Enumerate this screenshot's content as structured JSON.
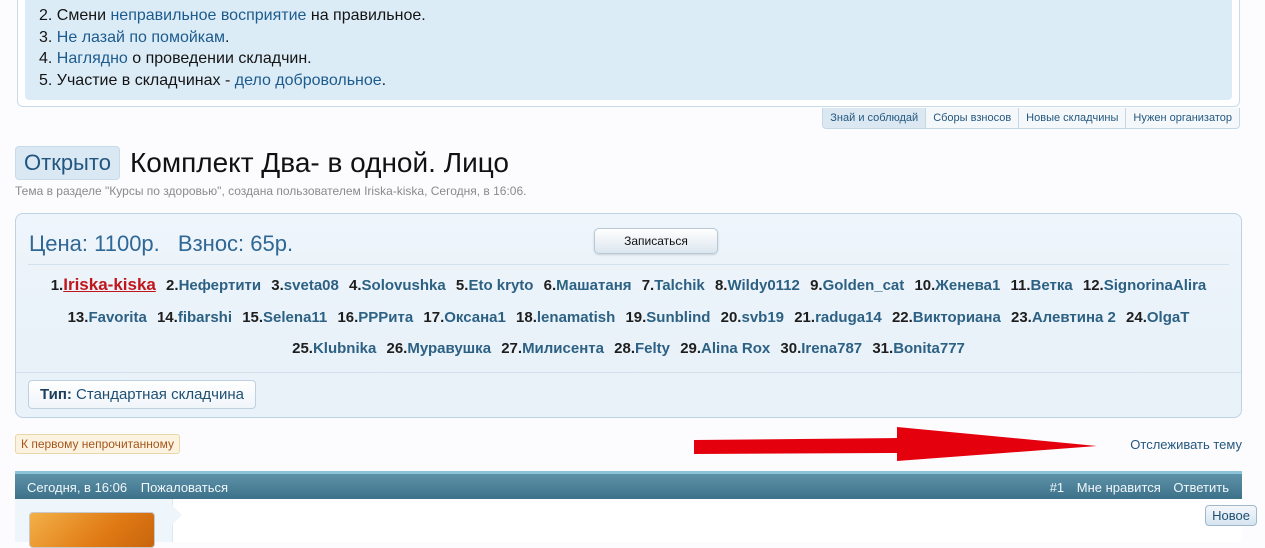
{
  "rules": {
    "lines": [
      {
        "num": "2.",
        "before": "Смени ",
        "link": "неправильное восприятие",
        "after": " на правильное."
      },
      {
        "num": "3.",
        "before": "",
        "link": "Не лазай по помойкам",
        "after": "."
      },
      {
        "num": "4.",
        "before": "",
        "link": "Наглядно",
        "after": " о проведении складчин."
      },
      {
        "num": "5.",
        "before": "Участие в складчинах - ",
        "link": "дело добровольное",
        "after": "."
      }
    ]
  },
  "subnav": [
    "Знай и соблюдай",
    "Сборы взносов",
    "Новые складчины",
    "Нужен организатор"
  ],
  "thread": {
    "status": "Открыто",
    "title": "Комплект Два- в одной. Лицо",
    "description": "Тема в разделе \"Курсы по здоровью\", создана пользователем Iriska-kiska, Сегодня, в 16:06."
  },
  "skladchina": {
    "price": "Цена: 1100р.",
    "fee": "Взнос: 65р.",
    "join_label": "Записаться",
    "participants": [
      "Iriska-kiska",
      "Нефертити",
      "sveta08",
      "Solovushka",
      "Eto kryto",
      "Машатаня",
      "Talchik",
      "Wildy0112",
      "Golden_cat",
      "Женева1",
      "Ветка",
      "SignorinaAlira",
      "Favorita",
      "fibarshi",
      "Selena11",
      "РРРита",
      "Оксана1",
      "lenamatish",
      "Sunblind",
      "svb19",
      "raduga14",
      "Викториана",
      "Алевтина 2",
      "OlgaT",
      "Klubnika",
      "Муравушка",
      "Милисента",
      "Felty",
      "Alina Rox",
      "Irena787",
      "Bonita777"
    ],
    "type_label": "Тип:",
    "type_value": "Стандартная складчина"
  },
  "actions": {
    "first_unread": "К первому непрочитанному",
    "watch": "Отслеживать тему"
  },
  "message": {
    "date": "Сегодня, в 16:06",
    "report": "Пожаловаться",
    "number": "#1",
    "like": "Мне нравится",
    "reply": "Ответить"
  },
  "new_button": "Новое",
  "colors": {
    "accent": "#2f6795",
    "link": "#2d6183",
    "organizer": "#c0161b",
    "annotation_arrow": "#e5000d",
    "message_bar": "#3c7189"
  },
  "icons": {
    "annotation": "red-arrow-icon"
  }
}
